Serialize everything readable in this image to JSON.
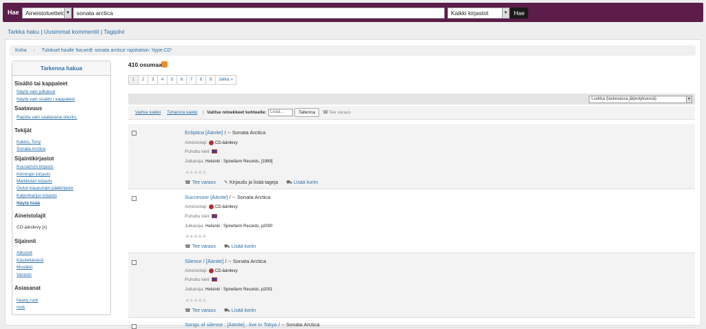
{
  "header": {
    "search_label": "Hae",
    "index_select": "Aineistoluettelo",
    "query": "sonata arctica",
    "library_select": "Kaikki kirjastot",
    "submit": "Hae"
  },
  "links": {
    "advanced": "Tarkka haku",
    "comments": "Uusimmat kommentit",
    "tagcloud": "Tagipilvi"
  },
  "breadcrumb": {
    "home": "Koha",
    "current": "Tulokset haulle 'kw,wrdl: sonata arctica' rajoituksin: 'itype:CD'"
  },
  "sidebar": {
    "title": "Tarkenna hakua",
    "content_heading": "Sisältö tai kappaleet",
    "content_links": [
      "Näytä vain julkaisut",
      "Näytä vain sisältö / kappaleet"
    ],
    "availability_heading": "Saatavuus",
    "availability_link": "Rajoita vain saatavana oleviin.",
    "authors_heading": "Tekijät",
    "authors": [
      "Kakko, Tony",
      "Sonata Arctica"
    ],
    "libraries_heading": "Sijaintikirjastot",
    "libraries": [
      "Kuusamon kirjasto",
      "Kiimingin kirjasto",
      "Maikkulan kirjasto",
      "Oulun kaupungin pääkirjasto",
      "Kaijonharjun kirjasto"
    ],
    "show_more": "Näytä lisää",
    "itemtypes_heading": "Aineistolajit",
    "itemtype": "CD-äänilevy [x]",
    "locations_heading": "Sijainnit",
    "locations": [
      "Aikuiset",
      "Käsiteltävänä",
      "Musiikki",
      "Varasto"
    ],
    "subjects_heading": "Asiasanat",
    "subjects": [
      "heavy rock",
      "rock"
    ]
  },
  "results": {
    "count": "410 osumaa",
    "pages": [
      "1",
      "2",
      "3",
      "4",
      "5",
      "6",
      "7",
      "8",
      "9",
      "Jatka »"
    ],
    "sort_select": "Luokka (laskevassa järjestyksessä)",
    "select_all": "Valitse kaikki",
    "clear_all": "Tyhjennä kaikki",
    "selected_label": "Valitse nimekkeet kohteelle:",
    "list_select": "Lisää...",
    "save": "Tallenna",
    "hold": "Tee varaus",
    "labels": {
      "type": "Aineistolaji:",
      "lang": "Puhuttu kieli:",
      "pub": "Julkaisija:"
    },
    "items": [
      {
        "title": "Ecliptica [Äänite]",
        "author": " / -- Sonata Arctica",
        "type": "CD-äänilevy",
        "pub": "Helsinki : Spinefarm Records, [1999]",
        "actions": [
          "Tee varaus",
          "Kirjaudu ja lisää tageja",
          "Lisää koriin"
        ]
      },
      {
        "title": "Successor [Äänite]",
        "author": " / -- Sonata Arctica",
        "type": "CD-äänilevy",
        "pub": "Helsinki : Spinefarm Records, p2000",
        "actions": [
          "Tee varaus",
          "Lisää koriin"
        ]
      },
      {
        "title": "Silence / [Äänite]",
        "author": " / -- Sonata Arctica",
        "type": "CD-äänilevy",
        "pub": "Helsinki : Spinefarm Records, p2001",
        "actions": [
          "Tee varaus",
          "Lisää koriin"
        ]
      },
      {
        "title": "Songs of silence : [Äänite] : live in Tokyo",
        "author": " / -- Sonata Arctica"
      }
    ],
    "stars": "★★★★★"
  }
}
